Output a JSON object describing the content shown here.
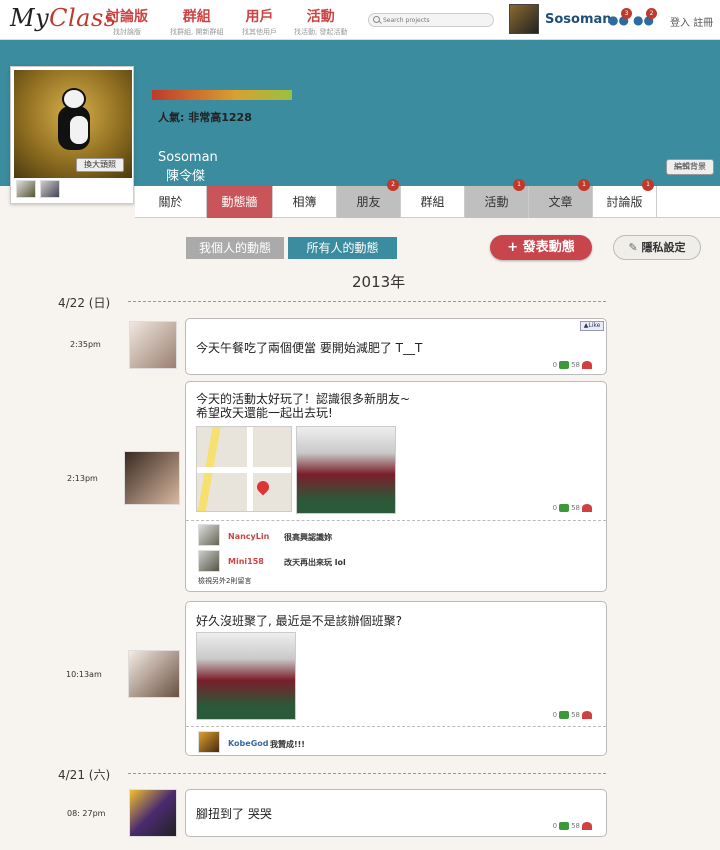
{
  "brand": {
    "logo_my": "My",
    "logo_class": "Class"
  },
  "nav": [
    {
      "label": "討論版",
      "sub": "找討論版"
    },
    {
      "label": "群組",
      "sub": "找群組, 開新群組"
    },
    {
      "label": "用戶",
      "sub": "找其他用戶"
    },
    {
      "label": "活動",
      "sub": "找活動, 發起活動"
    }
  ],
  "search": {
    "placeholder": "Search projects"
  },
  "user": {
    "name": "Sosoman",
    "friend_badge": "3",
    "msg_badge": "2"
  },
  "auth": {
    "login": "登入",
    "register": "註冊"
  },
  "profile": {
    "zoom_label": "換大頭照",
    "popularity": "人氣: 非常高1228",
    "name_en": "Sosoman",
    "name_zh": "陳令傑",
    "edit_bg_label": "編輯背景"
  },
  "tabs": [
    {
      "label": "關於"
    },
    {
      "label": "動態牆",
      "active": true
    },
    {
      "label": "相簿"
    },
    {
      "label": "朋友",
      "badge": "2"
    },
    {
      "label": "群組"
    },
    {
      "label": "活動",
      "badge": "1"
    },
    {
      "label": "文章",
      "badge": "1"
    },
    {
      "label": "討論版",
      "badge": "1"
    }
  ],
  "filters": {
    "mine": "我個人的動態",
    "all": "所有人的動態"
  },
  "actions": {
    "post": "發表動態",
    "privacy": "隱私設定"
  },
  "year": "2013年",
  "dates": {
    "d1": "4/22 (日)",
    "d2": "4/21 (六)"
  },
  "like_label": "Like",
  "posts": [
    {
      "time": "2:35pm",
      "text": "今天午餐吃了兩個便當 要開始減肥了 T__T",
      "comments": "0",
      "likes": "58"
    },
    {
      "time": "2:13pm",
      "text1": "今天的活動太好玩了！認識很多新朋友~",
      "text2": "希望改天還能一起出去玩!",
      "comments": "0",
      "likes": "58",
      "replies": [
        {
          "name": "NancyLin",
          "text": "很高興認識妳"
        },
        {
          "name": "Mini158",
          "text": "改天再出來玩 lol"
        }
      ],
      "more": "檢視另外2則留言"
    },
    {
      "time": "10:13am",
      "text": "好久沒班聚了, 最近是不是該辦個班聚?",
      "comments": "0",
      "likes": "58",
      "replies": [
        {
          "name": "KobeGod",
          "text": "我贊成!!!"
        }
      ]
    },
    {
      "time": "08: 27pm",
      "text": "腳扭到了 哭哭",
      "comments": "0",
      "likes": "58"
    }
  ]
}
